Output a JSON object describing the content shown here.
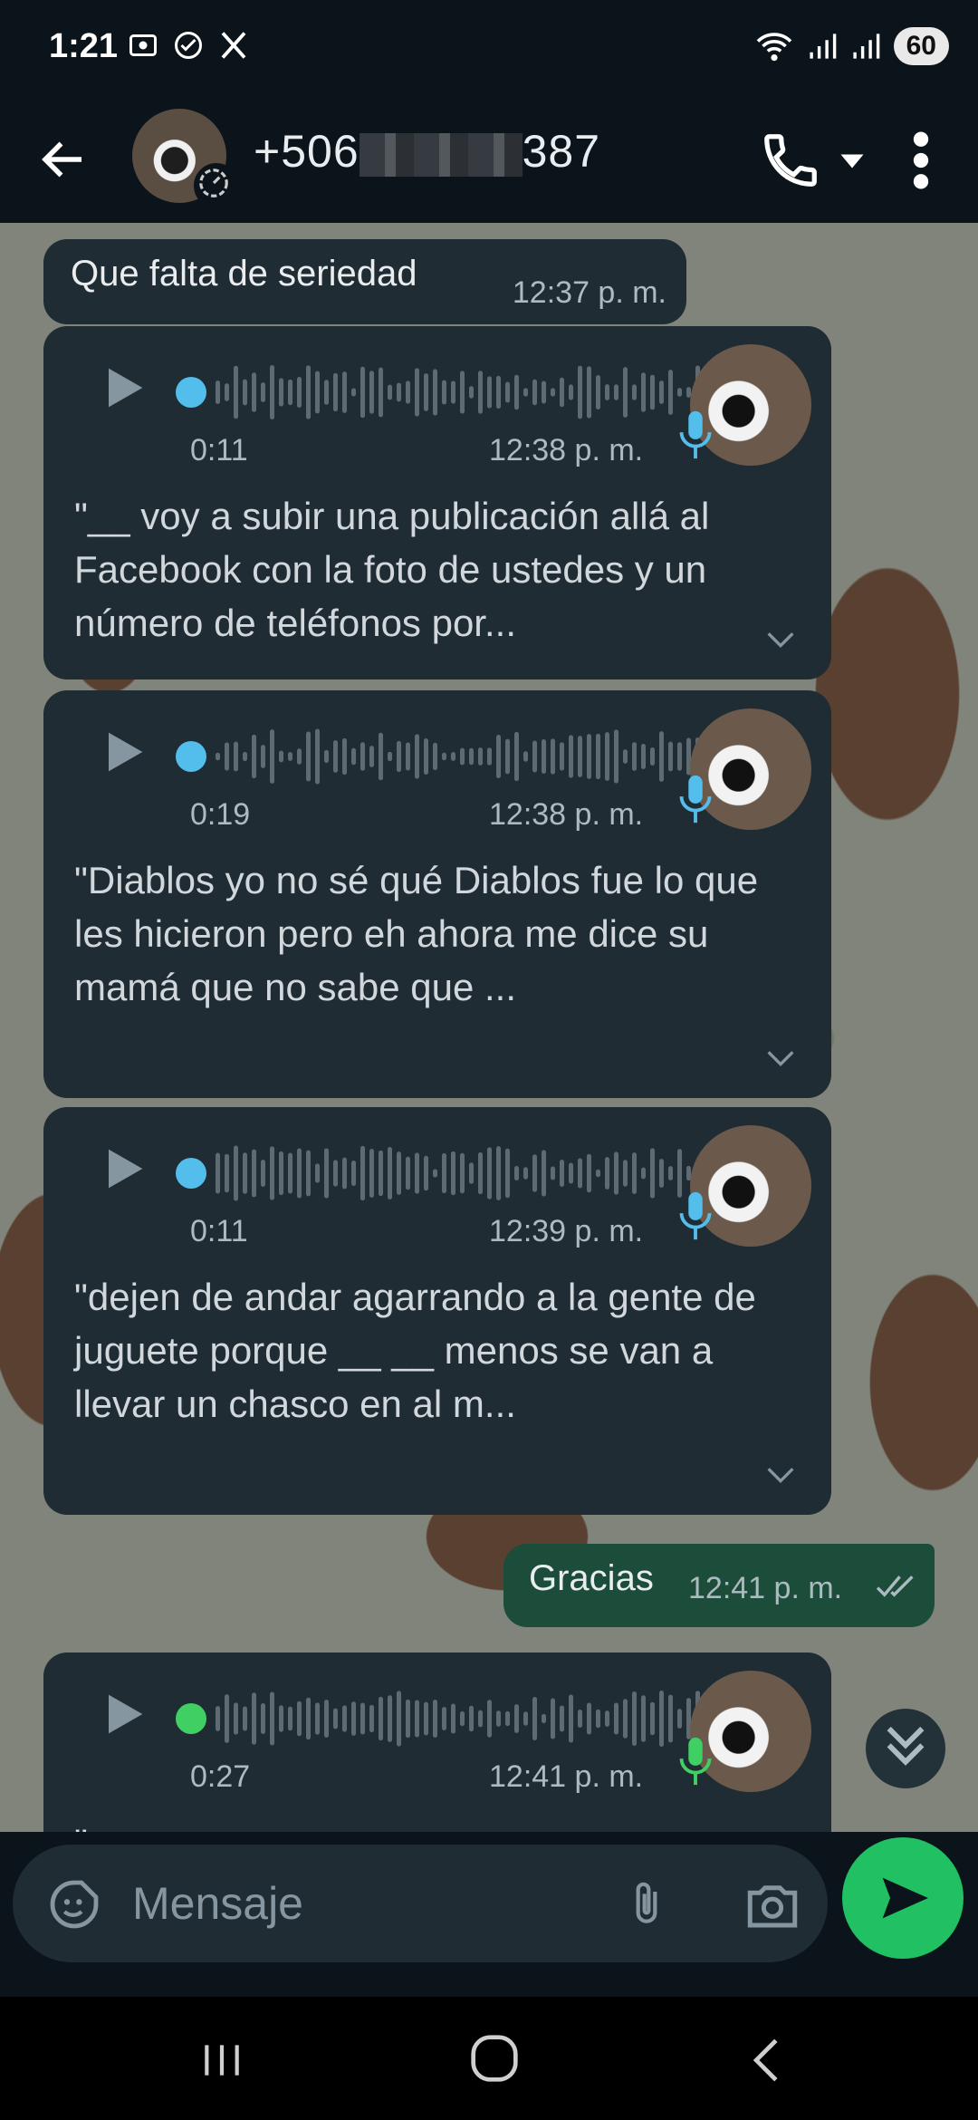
{
  "status": {
    "time": "1:21",
    "battery": "60",
    "icons_left": [
      "screenshot-icon",
      "vpn-icon",
      "x-app-icon"
    ],
    "icons_right": [
      "wifi-icon",
      "signal-icon",
      "signal-icon-2"
    ]
  },
  "header": {
    "contact_prefix": "+506",
    "contact_suffix": "387"
  },
  "messages": {
    "text1": {
      "text": "Que falta de seriedad",
      "time": "12:37 p. m."
    },
    "voice1": {
      "duration": "0:11",
      "time": "12:38 p. m.",
      "transcript": "\"__ voy a subir una publicación allá al Facebook con la foto de ustedes y un número de teléfonos por..."
    },
    "voice2": {
      "duration": "0:19",
      "time": "12:38 p. m.",
      "transcript": "\"Diablos yo no sé qué Diablos fue lo que les hicieron pero eh ahora me dice su mamá que no sabe que ..."
    },
    "voice3": {
      "duration": "0:11",
      "time": "12:39 p. m.",
      "transcript": "\"dejen de andar agarrando a la gente de juguete porque __ __ menos se van a llevar un chasco en al m..."
    },
    "out1": {
      "text": "Gracias",
      "time": "12:41 p. m."
    },
    "voice4": {
      "duration": "0:27",
      "time": "12:41 p. m.",
      "transcript": "\""
    }
  },
  "input": {
    "placeholder": "Mensaje"
  },
  "colors": {
    "accent": "#21c063",
    "played_dot": "#53bdeb",
    "unplayed_dot": "#3fcf63"
  }
}
